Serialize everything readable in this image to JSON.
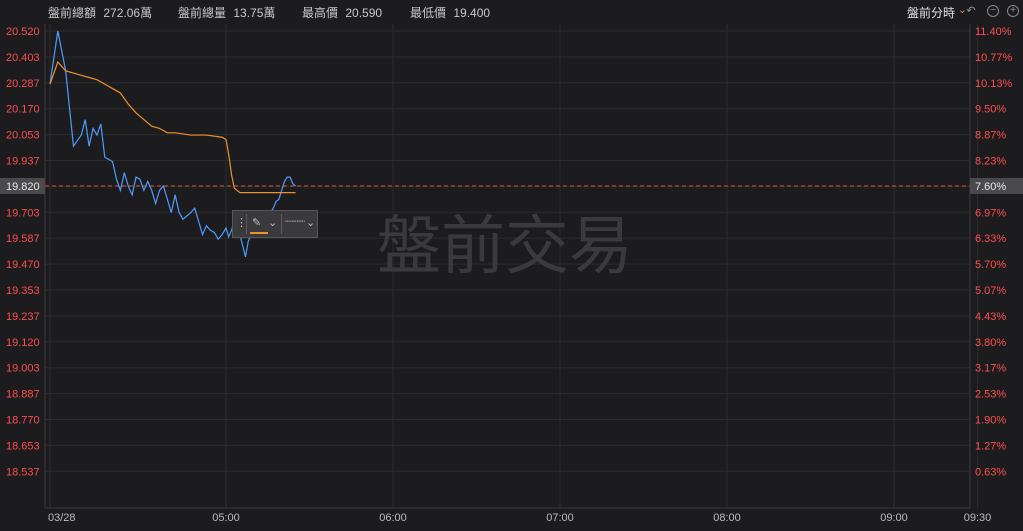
{
  "topbar": {
    "stats": [
      {
        "label": "盤前總額",
        "value": "272.06萬"
      },
      {
        "label": "盤前總量",
        "value": "13.75萬"
      },
      {
        "label": "最高價",
        "value": "20.590"
      },
      {
        "label": "最低價",
        "value": "19.400"
      }
    ],
    "mode_label": "盤前分時",
    "icons": [
      "chevron-down-icon",
      "undo-icon",
      "zoom-out-icon",
      "zoom-in-icon"
    ]
  },
  "watermark": "盤前交易",
  "colors": {
    "background": "#1c1c1e",
    "price_line": "#4f9bff",
    "avg_line": "#f0902a",
    "ref_line": "#e0561f",
    "axis_text_red": "#ff4d4d",
    "grid": "#2b2b2e"
  },
  "chart_data": {
    "type": "line",
    "y_ticks_left": [
      "20.520",
      "20.403",
      "20.287",
      "20.170",
      "20.053",
      "19.937",
      "19.820",
      "19.703",
      "19.587",
      "19.470",
      "19.353",
      "19.237",
      "19.120",
      "19.003",
      "18.887",
      "18.770",
      "18.653",
      "18.537"
    ],
    "y_ticks_right": [
      "11.40%",
      "10.77%",
      "10.13%",
      "9.50%",
      "8.87%",
      "8.23%",
      "7.60%",
      "6.97%",
      "6.33%",
      "5.70%",
      "5.07%",
      "4.43%",
      "3.80%",
      "3.17%",
      "2.53%",
      "1.90%",
      "1.27%",
      "0.63%"
    ],
    "x_ticks": [
      "03/28",
      "05:00",
      "06:00",
      "07:00",
      "08:00",
      "09:00",
      "09:30"
    ],
    "ylim": [
      18.5,
      20.55
    ],
    "reference_price": 19.82,
    "reference_label": "19.820",
    "reference_pct": "7.60%",
    "series": [
      {
        "role": "price",
        "points": [
          [
            0,
            20.28
          ],
          [
            2,
            20.52
          ],
          [
            4,
            20.34
          ],
          [
            6,
            20.0
          ],
          [
            8,
            20.05
          ],
          [
            9,
            20.12
          ],
          [
            10,
            20.0
          ],
          [
            11,
            20.08
          ],
          [
            12,
            20.05
          ],
          [
            13,
            20.1
          ],
          [
            14,
            19.95
          ],
          [
            16,
            19.93
          ],
          [
            17,
            19.85
          ],
          [
            18,
            19.8
          ],
          [
            19,
            19.88
          ],
          [
            20,
            19.82
          ],
          [
            21,
            19.78
          ],
          [
            22,
            19.86
          ],
          [
            23,
            19.85
          ],
          [
            24,
            19.8
          ],
          [
            25,
            19.84
          ],
          [
            26,
            19.8
          ],
          [
            27,
            19.74
          ],
          [
            28,
            19.8
          ],
          [
            29,
            19.82
          ],
          [
            30,
            19.76
          ],
          [
            31,
            19.7
          ],
          [
            32,
            19.78
          ],
          [
            33,
            19.7
          ],
          [
            34,
            19.67
          ],
          [
            36,
            19.7
          ],
          [
            37,
            19.72
          ],
          [
            38,
            19.66
          ],
          [
            39,
            19.6
          ],
          [
            40,
            19.64
          ],
          [
            41,
            19.62
          ],
          [
            42,
            19.61
          ],
          [
            43,
            19.58
          ],
          [
            44,
            19.6
          ],
          [
            45,
            19.63
          ],
          [
            46,
            19.59
          ],
          [
            47,
            19.62
          ],
          [
            48,
            19.66
          ],
          [
            49,
            19.65
          ],
          [
            50,
            19.6
          ],
          [
            51,
            19.55
          ],
          [
            52,
            19.5
          ],
          [
            53,
            19.57
          ],
          [
            54,
            19.6
          ],
          [
            55,
            19.63
          ],
          [
            56,
            19.64
          ],
          [
            57,
            19.66
          ],
          [
            58,
            19.66
          ],
          [
            59,
            19.67
          ],
          [
            60,
            19.68
          ],
          [
            61,
            19.7
          ],
          [
            62,
            19.72
          ],
          [
            63,
            19.75
          ],
          [
            64,
            19.76
          ],
          [
            65,
            19.8
          ],
          [
            66,
            19.84
          ],
          [
            67,
            19.86
          ],
          [
            68,
            19.86
          ],
          [
            69,
            19.83
          ],
          [
            70,
            19.82
          ]
        ]
      },
      {
        "role": "average",
        "points": [
          [
            0,
            20.28
          ],
          [
            2,
            20.38
          ],
          [
            4,
            20.34
          ],
          [
            6,
            20.33
          ],
          [
            8,
            20.32
          ],
          [
            10,
            20.31
          ],
          [
            12,
            20.3
          ],
          [
            14,
            20.28
          ],
          [
            16,
            20.26
          ],
          [
            18,
            20.24
          ],
          [
            20,
            20.19
          ],
          [
            22,
            20.15
          ],
          [
            24,
            20.12
          ],
          [
            26,
            20.09
          ],
          [
            28,
            20.08
          ],
          [
            30,
            20.06
          ],
          [
            32,
            20.06
          ],
          [
            36,
            20.05
          ],
          [
            40,
            20.05
          ],
          [
            44,
            20.04
          ],
          [
            45,
            20.03
          ],
          [
            46,
            19.96
          ],
          [
            47,
            19.87
          ],
          [
            48,
            19.81
          ],
          [
            50,
            19.79
          ],
          [
            55,
            19.79
          ],
          [
            60,
            19.79
          ],
          [
            65,
            19.79
          ],
          [
            70,
            19.79
          ]
        ]
      }
    ],
    "x_tick_minutes": [
      0,
      45,
      105,
      165,
      225,
      285,
      315
    ]
  }
}
